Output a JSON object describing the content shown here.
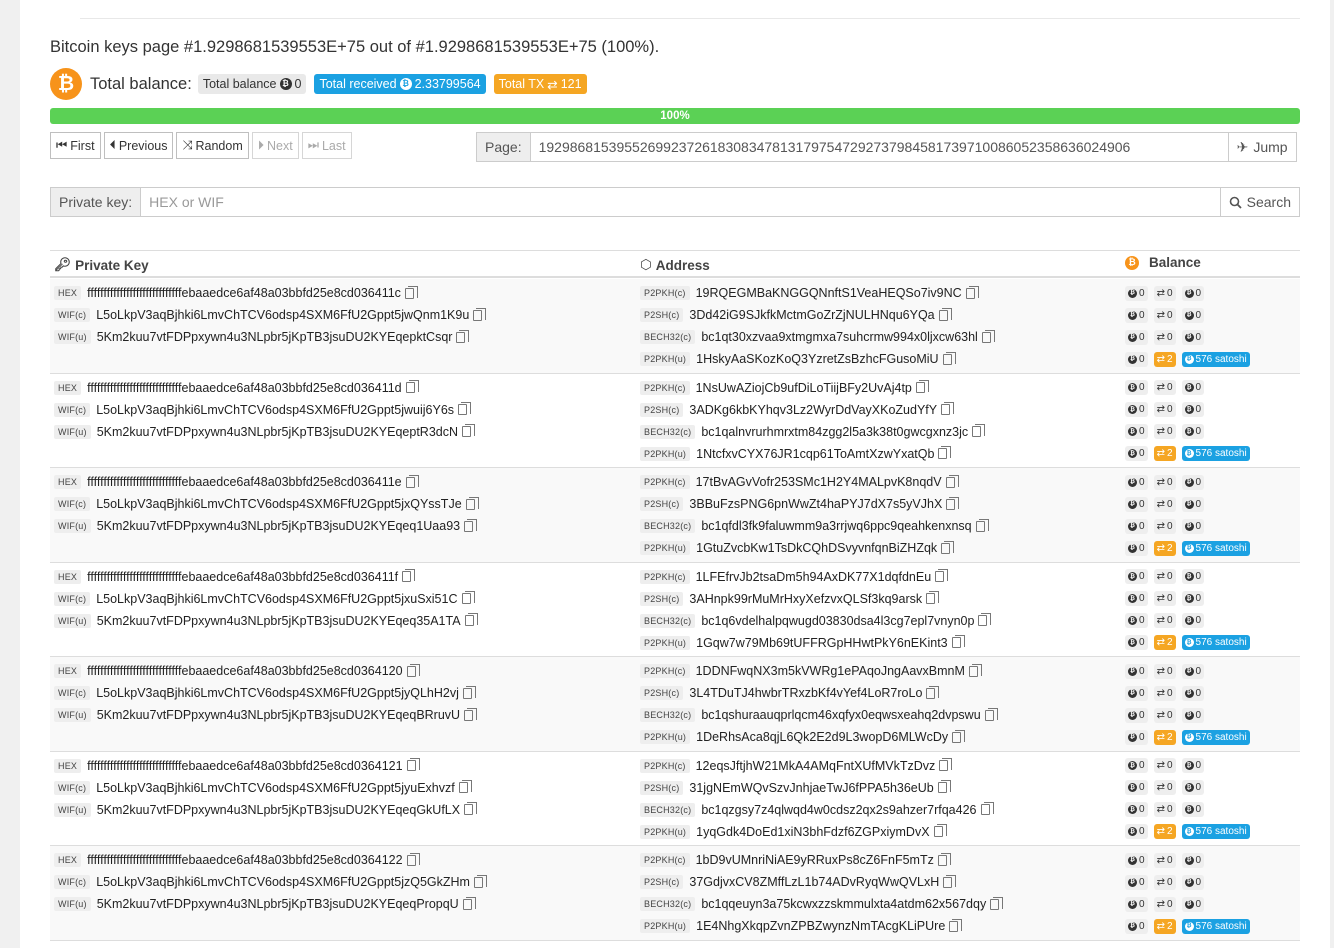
{
  "title": "Bitcoin keys page #1.9298681539553E+75 out of #1.9298681539553E+75 (100%).",
  "balance": {
    "label": "Total balance:",
    "total_balance_label": "Total balance",
    "total_balance_value": "0",
    "total_received_label": "Total received",
    "total_received_value": "2.33799564",
    "total_tx_label": "Total TX",
    "total_tx_value": "121"
  },
  "progress": {
    "percent": 100,
    "label": "100%"
  },
  "nav": {
    "first": "First",
    "previous": "Previous",
    "random": "Random",
    "next": "Next",
    "last": "Last"
  },
  "page_input": {
    "label": "Page:",
    "value": "192986815395526992372618308347813179754729273798458173971008605235863602490​6",
    "jump": "Jump"
  },
  "private_key_search": {
    "label": "Private key:",
    "placeholder": "HEX or WIF",
    "button": "Search"
  },
  "table": {
    "headers": {
      "private_key": "Private Key",
      "address": "Address",
      "balance": "Balance"
    },
    "zero": "0",
    "tx_count": "2",
    "satoshi": "576 satoshi",
    "rows": [
      {
        "hex": "fffffffffffffffffffffffffffffebaaedce6af48a03bbfd25e8cd036411c",
        "wifc": "L5oLkpV3aqBjhki6LmvChTCV6odsp4SXM6FfU2Gppt5jwQnm1K9u",
        "wifu": "5Km2kuu7vtFDPpxywn4u3NLpbr5jKpTB3jsuDU2KYEqepktCsqr",
        "p2pkhc": "19RQEGMBaKNGGQNnftS1VeaHEQSo7iv9NC",
        "p2sh": "3Dd42iG9SJkfkMctmGoZrZjNULHNqu6YQa",
        "bech32": "bc1qt30xzvaa9xtmgmxa7suhcrmw994x0ljxcw63hl",
        "p2pkhu": "1HskyAaSKozKoQ3YzretZsBzhcFGusoMiU"
      },
      {
        "hex": "fffffffffffffffffffffffffffffebaaedce6af48a03bbfd25e8cd036411d",
        "wifc": "L5oLkpV3aqBjhki6LmvChTCV6odsp4SXM6FfU2Gppt5jwuij6Y6s",
        "wifu": "5Km2kuu7vtFDPpxywn4u3NLpbr5jKpTB3jsuDU2KYEqeptR3dcN",
        "p2pkhc": "1NsUwAZiojCb9ufDiLoTiijBFy2UvAj4tp",
        "p2sh": "3ADKg6kbKYhqv3Lz2WyrDdVayXKoZudYfY",
        "bech32": "bc1qalnvrurhmrxtm84zgg2l5a3k38t0gwcgxnz3jc",
        "p2pkhu": "1NtcfxvCYX76JR1cqp61ToAmtXzwYxatQb"
      },
      {
        "hex": "fffffffffffffffffffffffffffffebaaedce6af48a03bbfd25e8cd036411e",
        "wifc": "L5oLkpV3aqBjhki6LmvChTCV6odsp4SXM6FfU2Gppt5jxQYssTJe",
        "wifu": "5Km2kuu7vtFDPpxywn4u3NLpbr5jKpTB3jsuDU2KYEqeq1Uaa93",
        "p2pkhc": "17tBvAGvVofr253SMc1H2Y4MALpvK8nqdV",
        "p2sh": "3BBuFzsPNG6pnWwZt4haPYJ7dX7s5yVJhX",
        "bech32": "bc1qfdl3fk9faluwmm9a3rrjwq6ppc9qeahkenxnsq",
        "p2pkhu": "1GtuZvcbKw1TsDkCQhDSvyvnfqnBiZHZqk"
      },
      {
        "hex": "fffffffffffffffffffffffffffffebaaedce6af48a03bbfd25e8cd036411f",
        "wifc": "L5oLkpV3aqBjhki6LmvChTCV6odsp4SXM6FfU2Gppt5jxuSxi51C",
        "wifu": "5Km2kuu7vtFDPpxywn4u3NLpbr5jKpTB3jsuDU2KYEqeq35A1TA",
        "p2pkhc": "1LFEfrvJb2tsaDm5h94AxDK77X1dqfdnEu",
        "p2sh": "3AHnpk99rMuMrHxyXefzvxQLSf3kq9arsk",
        "bech32": "bc1q6vdelhalpqwugd03830dsa4l3cg7epl7vnyn0p",
        "p2pkhu": "1Gqw7w79Mb69tUFFRGpHHwtPkY6nEKint3"
      },
      {
        "hex": "fffffffffffffffffffffffffffffebaaedce6af48a03bbfd25e8cd0364120",
        "wifc": "L5oLkpV3aqBjhki6LmvChTCV6odsp4SXM6FfU2Gppt5jyQLhH2vj",
        "wifu": "5Km2kuu7vtFDPpxywn4u3NLpbr5jKpTB3jsuDU2KYEqeqBRruvU",
        "p2pkhc": "1DDNFwqNX3m5kVWRg1ePAqoJngAavxBmnM",
        "p2sh": "3L4TDuTJ4hwbrTRxzbKf4vYef4LoR7roLo",
        "bech32": "bc1qshuraauqprlqcm46xqfyx0eqwsxeahq2dvpswu",
        "p2pkhu": "1DeRhsAca8qjL6Qk2E2d9L3wopD6MLWcDy"
      },
      {
        "hex": "fffffffffffffffffffffffffffffebaaedce6af48a03bbfd25e8cd0364121",
        "wifc": "L5oLkpV3aqBjhki6LmvChTCV6odsp4SXM6FfU2Gppt5jyuExhvzf",
        "wifu": "5Km2kuu7vtFDPpxywn4u3NLpbr5jKpTB3jsuDU2KYEqeqGkUfLX",
        "p2pkhc": "12eqsJftjhW21MkA4AMqFntXUfMVkTzDvz",
        "p2sh": "31jgNEmWQvSzvJnhjaeTwJ6fPPA5h36eUb",
        "bech32": "bc1qzgsy7z4qlwqd4w0cdsz2qx2s9ahzer7rfqa426",
        "p2pkhu": "1yqGdk4DoEd1xiN3bhFdzf6ZGPxiymDvX"
      },
      {
        "hex": "fffffffffffffffffffffffffffffebaaedce6af48a03bbfd25e8cd0364122",
        "wifc": "L5oLkpV3aqBjhki6LmvChTCV6odsp4SXM6FfU2Gppt5jzQ5GkZHm",
        "wifu": "5Km2kuu7vtFDPpxywn4u3NLpbr5jKpTB3jsuDU2KYEqeqPropqU",
        "p2pkhc": "1bD9vUMnriNiAE9yRRuxPs8cZ6FnF5mTz",
        "p2sh": "37GdjvxCV8ZMffLzL1b74ADvRyqWwQVLxH",
        "bech32": "bc1qqeuyn3a75kcwxzzskmmulxta4atdm62x567dqy",
        "p2pkhu": "1E4NhgXkqpZvnZPBZwynzNmTAcgKLiPUre"
      }
    ],
    "tags": {
      "hex": "HEX",
      "wifc": "WIF(c)",
      "wifu": "WIF(u)",
      "p2pkhc": "P2PKH(c)",
      "p2sh": "P2SH(c)",
      "bech32": "BECH32(c)",
      "p2pkhu": "P2PKH(u)"
    }
  },
  "colors": {
    "bitcoin_orange": "#f7931a",
    "received_blue": "#1ba1e2",
    "tx_orange": "#f5a623",
    "progress_green": "#5bd155"
  },
  "icons": [
    "bitcoin-icon",
    "first-icon",
    "previous-icon",
    "random-icon",
    "next-icon",
    "last-icon",
    "jump-icon",
    "search-icon",
    "key-icon",
    "address-icon",
    "copy-icon",
    "transfer-icon"
  ]
}
